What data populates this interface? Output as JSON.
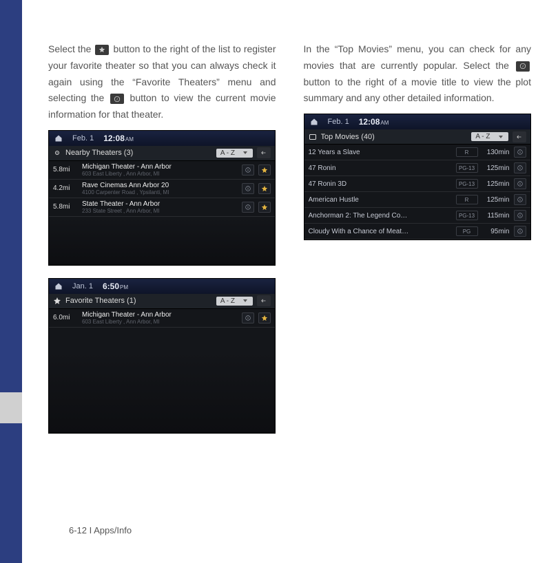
{
  "left_col": {
    "para1_a": "Select the ",
    "para1_b": " button to the right of the list to register your favorite theater so that you can always check it again using the “Favorite Theaters” menu and selecting the ",
    "para1_c": " button to view the current movie information for that theater."
  },
  "right_col": {
    "para2_a": "In the “Top Movies” menu, you can check for any movies that are currently popular. Select the ",
    "para2_b": " button to the right of a movie title to view the plot summary and any other detailed information."
  },
  "shot1": {
    "date": "Feb.  1",
    "time": "12:08",
    "ampm": "AM",
    "header_title": "Nearby Theaters (3)",
    "sort_label": "A - Z",
    "theaters": [
      {
        "dist": "5.8mi",
        "name": "Michigan Theater - Ann Arbor",
        "addr": "603 East Liberty , Ann Arbor, MI"
      },
      {
        "dist": "4.2mi",
        "name": "Rave Cinemas Ann Arbor 20",
        "addr": "4100 Carpenter Road , Ypsilanti, MI"
      },
      {
        "dist": "5.8mi",
        "name": "State Theater - Ann Arbor",
        "addr": "233 State Street , Ann Arbor, MI"
      }
    ]
  },
  "shot2": {
    "date": "Jan.  1",
    "time": "6:50",
    "ampm": "PM",
    "header_title": "Favorite Theaters (1)",
    "sort_label": "A - Z",
    "theaters": [
      {
        "dist": "6.0mi",
        "name": "Michigan Theater - Ann Arbor",
        "addr": "603 East Liberty , Ann Arbor, MI"
      }
    ]
  },
  "shot3": {
    "date": "Feb.  1",
    "time": "12:08",
    "ampm": "AM",
    "header_title": "Top Movies (40)",
    "sort_label": "A - Z",
    "movies": [
      {
        "title": "12 Years a Slave",
        "rating": "R",
        "dur": "130min"
      },
      {
        "title": "47 Ronin",
        "rating": "PG-13",
        "dur": "125min"
      },
      {
        "title": "47 Ronin 3D",
        "rating": "PG-13",
        "dur": "125min"
      },
      {
        "title": "American Hustle",
        "rating": "R",
        "dur": "125min"
      },
      {
        "title": "Anchorman 2: The Legend Co…",
        "rating": "PG-13",
        "dur": "115min"
      },
      {
        "title": "Cloudy With a Chance of Meat…",
        "rating": "PG",
        "dur": "95min"
      }
    ]
  },
  "footer": "6-12 I Apps/Info"
}
